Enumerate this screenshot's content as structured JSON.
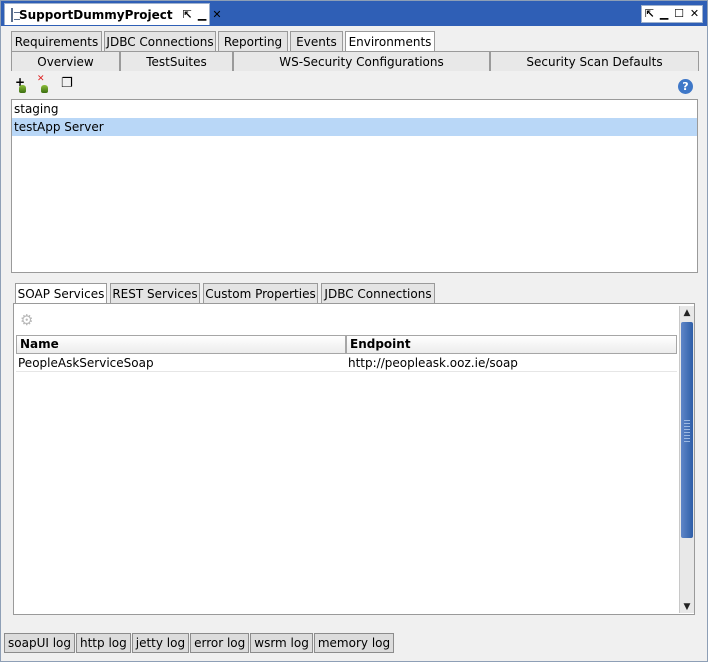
{
  "window": {
    "title": "SupportDummyProject",
    "pin_glyph": "⇱",
    "minimize_glyph": "▁",
    "close_glyph": "✕",
    "controls": [
      "⇱",
      "▁",
      "☐",
      "✕"
    ]
  },
  "tabs_row1": [
    {
      "label": "Requirements",
      "selected": false
    },
    {
      "label": "JDBC Connections",
      "selected": false
    },
    {
      "label": "Reporting",
      "selected": false
    },
    {
      "label": "Events",
      "selected": false
    },
    {
      "label": "Environments",
      "selected": true
    }
  ],
  "tabs_row2": [
    "Overview",
    "TestSuites",
    "WS-Security Configurations",
    "Security Scan Defaults"
  ],
  "toolbar": {
    "add_glyph": "+",
    "remove_glyph": "✕",
    "clone_glyph": "❐",
    "help_glyph": "?"
  },
  "environments": [
    {
      "label": "staging",
      "selected": false
    },
    {
      "label": "testApp Server",
      "selected": true
    }
  ],
  "lower_tabs": [
    {
      "label": "SOAP Services",
      "selected": true
    },
    {
      "label": "REST Services",
      "selected": false
    },
    {
      "label": "Custom Properties",
      "selected": false
    },
    {
      "label": "JDBC Connections",
      "selected": false
    }
  ],
  "services_table": {
    "gear_glyph": "⚙",
    "columns": [
      "Name",
      "Endpoint"
    ],
    "rows": [
      {
        "name": "PeopleAskServiceSoap",
        "endpoint": "http://peopleask.ooz.ie/soap"
      }
    ]
  },
  "scrollbar": {
    "up_glyph": "▲",
    "down_glyph": "▼"
  },
  "log_tabs": [
    "soapUI log",
    "http log",
    "jetty log",
    "error log",
    "wsrm log",
    "memory log"
  ],
  "colors": {
    "title_bar": "#2f5fb6",
    "selection": "#b9d7f7",
    "scroll_thumb": "#2e5ea8"
  }
}
